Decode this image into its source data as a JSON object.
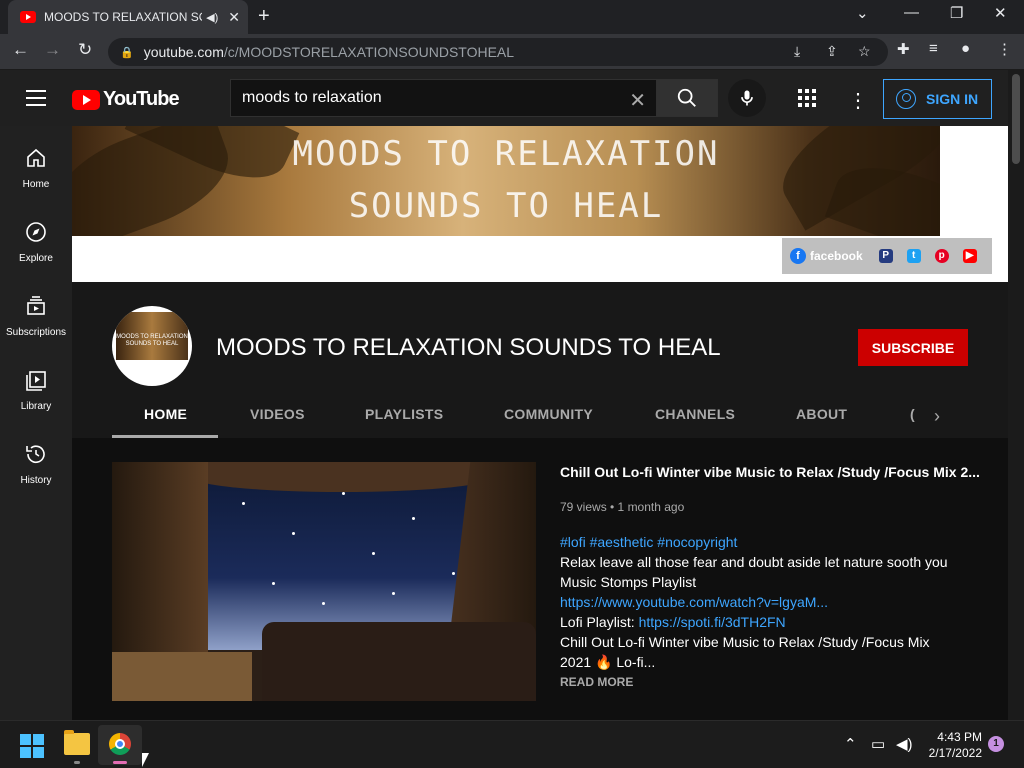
{
  "browser": {
    "tab_title": "MOODS TO RELAXATION SO",
    "url_host": "youtube.com",
    "url_path": "/c/MOODSTORELAXATIONSOUNDSTOHEAL"
  },
  "header": {
    "logo_text": "YouTube",
    "search_query": "moods to relaxation",
    "signin_label": "SIGN IN"
  },
  "guide": {
    "items": [
      {
        "label": "Home",
        "icon": "home-icon"
      },
      {
        "label": "Explore",
        "icon": "compass-icon"
      },
      {
        "label": "Subscriptions",
        "icon": "subscriptions-icon"
      },
      {
        "label": "Library",
        "icon": "library-icon"
      },
      {
        "label": "History",
        "icon": "history-icon"
      }
    ]
  },
  "banner": {
    "line1": "MOODS TO RELAXATION",
    "line2": "SOUNDS TO HEAL",
    "social_facebook": "facebook"
  },
  "channel": {
    "avatar_text": "MOODS TO RELAXATION SOUNDS TO HEAL",
    "name": "MOODS TO RELAXATION SOUNDS TO HEAL",
    "subscribe_label": "SUBSCRIBE",
    "tabs": [
      "HOME",
      "VIDEOS",
      "PLAYLISTS",
      "COMMUNITY",
      "CHANNELS",
      "ABOUT",
      "("
    ],
    "active_tab": "HOME"
  },
  "featured": {
    "title": "Chill Out Lo-fi Winter vibe Music to Relax /Study /Focus Mix 2...",
    "meta": "79 views • 1 month ago",
    "hashtags": "#lofi #aesthetic #nocopyright",
    "desc_line1": "Relax leave all those fear and doubt aside let nature sooth you",
    "desc_line2": "Music Stomps Playlist",
    "link1": "https://www.youtube.com/watch?v=lgyaM...",
    "lofi_label": "Lofi Playlist: ",
    "link2": "https://spoti.fi/3dTH2FN",
    "desc_line3": "Chill Out Lo-fi Winter vibe Music to Relax /Study /Focus Mix",
    "desc_line4": "2021 🔥 Lo-fi...",
    "read_more": "READ MORE"
  },
  "taskbar": {
    "time": "4:43 PM",
    "date": "2/17/2022",
    "notifications": "1"
  },
  "colors": {
    "accent_blue": "#3ea6ff",
    "subscribe_red": "#cc0000",
    "yt_red": "#ff0000"
  }
}
